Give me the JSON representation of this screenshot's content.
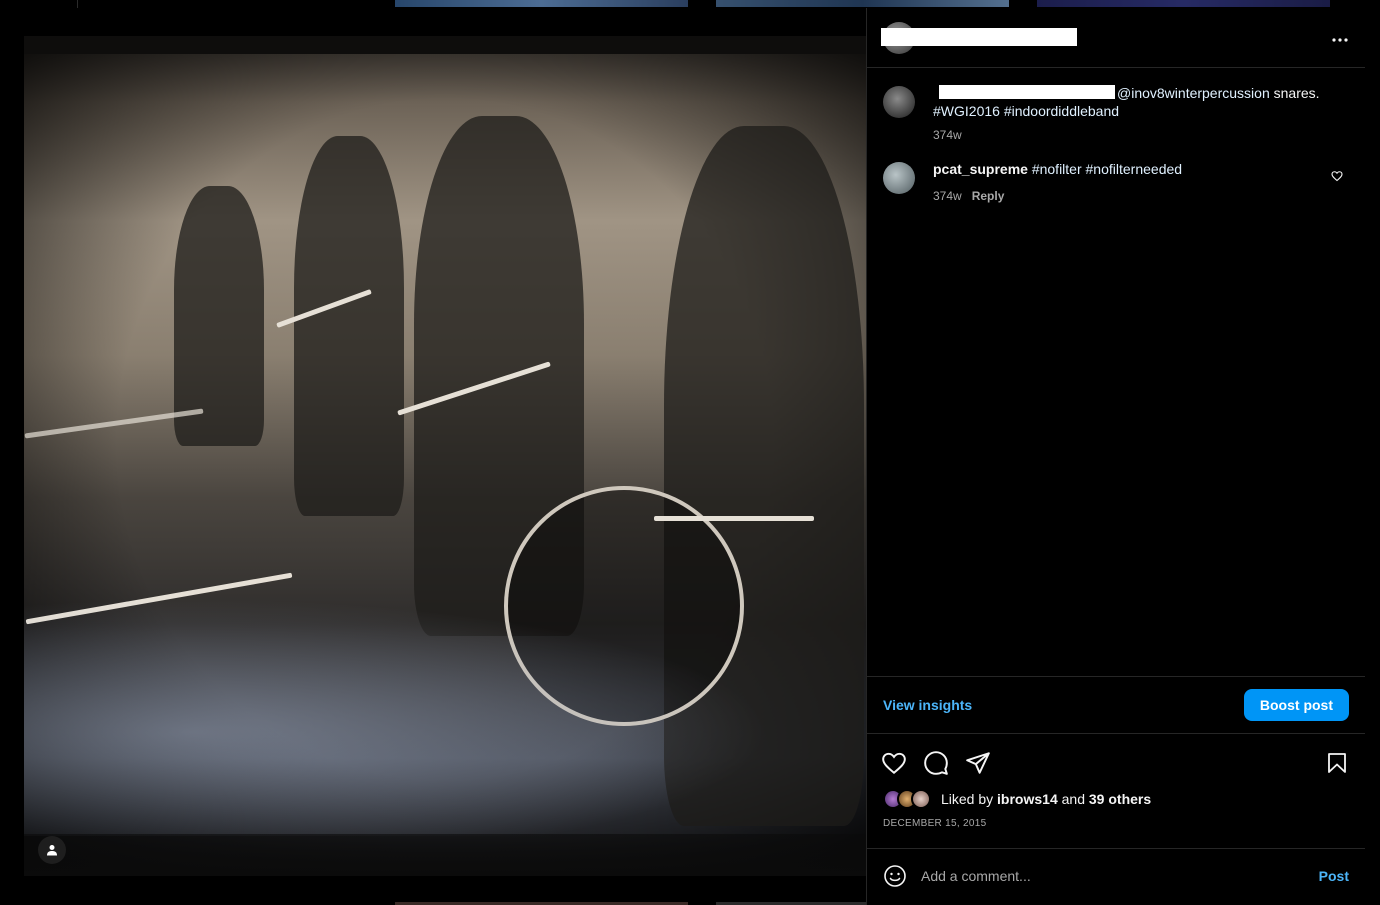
{
  "post": {
    "caption": {
      "mention": "@inov8winterpercussion",
      "text_after": " snares.",
      "hashtags": "#WGI2016 #indoordiddleband",
      "time": "374w"
    },
    "comments": [
      {
        "username": "pcat_supreme",
        "text": "#nofilter #nofilterneeded",
        "time": "374w",
        "reply_label": "Reply"
      }
    ],
    "insights_label": "View insights",
    "boost_label": "Boost post",
    "likes": {
      "prefix": "Liked by",
      "user": "ibrows14",
      "conjunction": "and",
      "others": "39 others"
    },
    "date": "DECEMBER 15, 2015",
    "add_comment": {
      "placeholder": "Add a comment...",
      "post_label": "Post"
    },
    "more_icon": "more-horizontal-icon"
  },
  "colors": {
    "accent_link": "#4cb5f9",
    "button_blue": "#0095f6",
    "background": "#000000",
    "border": "#262626",
    "secondary_text": "#a8a8a8"
  }
}
